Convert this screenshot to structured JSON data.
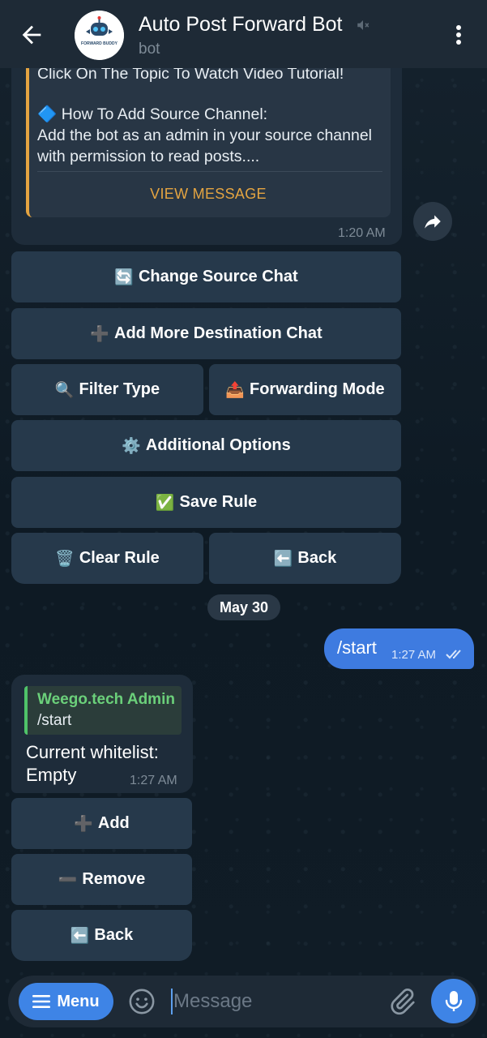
{
  "header": {
    "title": "Auto Post Forward Bot",
    "subtitle": "bot",
    "avatar_text": "FORWARD BUDDY"
  },
  "message_top": {
    "quote_line1": "Click On The Topic To Watch Video Tutorial!",
    "quote_line2": "🔷 How To Add Source Channel:",
    "quote_line3": "Add the bot as an admin in your source channel",
    "quote_line4": "with permission to read posts....",
    "view_message": "VIEW MESSAGE",
    "time": "1:20 AM"
  },
  "keyboard_main": {
    "change_source": {
      "emoji": "🔄",
      "label": "Change Source Chat"
    },
    "add_destination": {
      "emoji": "➕",
      "label": "Add More Destination Chat"
    },
    "filter_type": {
      "emoji": "🔍",
      "label": "Filter Type"
    },
    "forwarding_mode": {
      "emoji": "📤",
      "label": "Forwarding Mode"
    },
    "additional_options": {
      "emoji": "⚙️",
      "label": "Additional Options"
    },
    "save_rule": {
      "emoji": "✅",
      "label": "Save Rule"
    },
    "clear_rule": {
      "emoji": "🗑️",
      "label": "Clear Rule"
    },
    "back": {
      "emoji": "⬅️",
      "label": "Back"
    }
  },
  "date_separator": "May 30",
  "outgoing": {
    "text": "/start",
    "time": "1:27 AM"
  },
  "incoming": {
    "reply_name": "Weego.tech Admin",
    "reply_text": "/start",
    "text": "Current whitelist: Empty",
    "time": "1:27 AM"
  },
  "keyboard_whitelist": {
    "add": {
      "emoji": "➕",
      "label": "Add"
    },
    "remove": {
      "emoji": "➖",
      "label": "Remove"
    },
    "back": {
      "emoji": "⬅️",
      "label": "Back"
    }
  },
  "input": {
    "menu_label": "Menu",
    "placeholder": "Message"
  },
  "colors": {
    "accent": "#3e84e6",
    "quote_border": "#e4a441",
    "reply_green": "#4fc369",
    "header_bg": "#1e2a36",
    "button_bg": "#26394b"
  }
}
